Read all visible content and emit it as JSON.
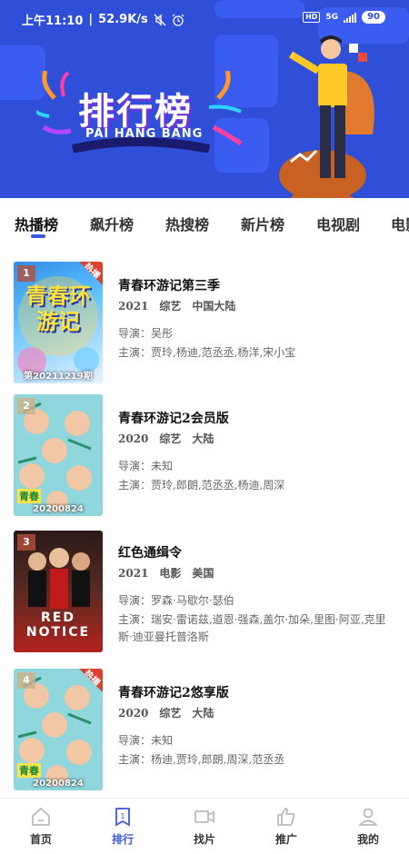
{
  "status_bar": {
    "time": "上午11:10",
    "net_speed": "52.9K/s",
    "hd": "HD",
    "network": "5G",
    "battery": "90"
  },
  "banner": {
    "title": "排行榜",
    "subtitle": "PAI HANG BANG"
  },
  "tabs": [
    "热播榜",
    "飙升榜",
    "热搜榜",
    "新片榜",
    "电视剧",
    "电影"
  ],
  "active_tab": 0,
  "list": [
    {
      "rank": "1",
      "title": "青春环游记第三季",
      "year": "2021",
      "genre": "综艺",
      "region": "中国大陆",
      "director_label": "导演：",
      "director": "吴彤",
      "cast_label": "主演：",
      "cast": "贾玲,杨迪,范丞丞,杨洋,宋小宝",
      "poster_date": "第20211219期",
      "hot": "热播",
      "poster_text": "青春环游记"
    },
    {
      "rank": "2",
      "title": "青春环游记2会员版",
      "year": "2020",
      "genre": "综艺",
      "region": "大陆",
      "director_label": "导演：",
      "director": "未知",
      "cast_label": "主演：",
      "cast": "贾玲,郎朗,范丞丞,杨迪,周深",
      "poster_date": "20200824",
      "hot": "",
      "poster_text": "青春"
    },
    {
      "rank": "3",
      "title": "红色通缉令",
      "year": "2021",
      "genre": "电影",
      "region": "美国",
      "director_label": "导演：",
      "director": "罗森·马歇尔·瑟伯",
      "cast_label": "主演：",
      "cast": "瑞安·雷诺兹,道恩·强森,盖尔·加朵,里图·阿亚,克里斯·迪亚曼托普洛斯",
      "poster_date": "",
      "hot": "",
      "poster_text": "RED NOTICE"
    },
    {
      "rank": "4",
      "title": "青春环游记2悠享版",
      "year": "2020",
      "genre": "综艺",
      "region": "大陆",
      "director_label": "导演：",
      "director": "未知",
      "cast_label": "主演：",
      "cast": "杨迪,贾玲,郎朗,周深,范丞丞",
      "poster_date": "20200824",
      "hot": "热播",
      "poster_text": "青春"
    }
  ],
  "bottom_nav": [
    {
      "label": "首页",
      "icon": "home-icon"
    },
    {
      "label": "排行",
      "icon": "ranking-icon"
    },
    {
      "label": "找片",
      "icon": "video-camera-icon"
    },
    {
      "label": "推广",
      "icon": "thumbs-up-icon"
    },
    {
      "label": "我的",
      "icon": "user-icon"
    }
  ],
  "colors": {
    "banner_bg": "#2f4fd9",
    "accent": "#3b57e0",
    "hot_tag": "#d84331"
  }
}
